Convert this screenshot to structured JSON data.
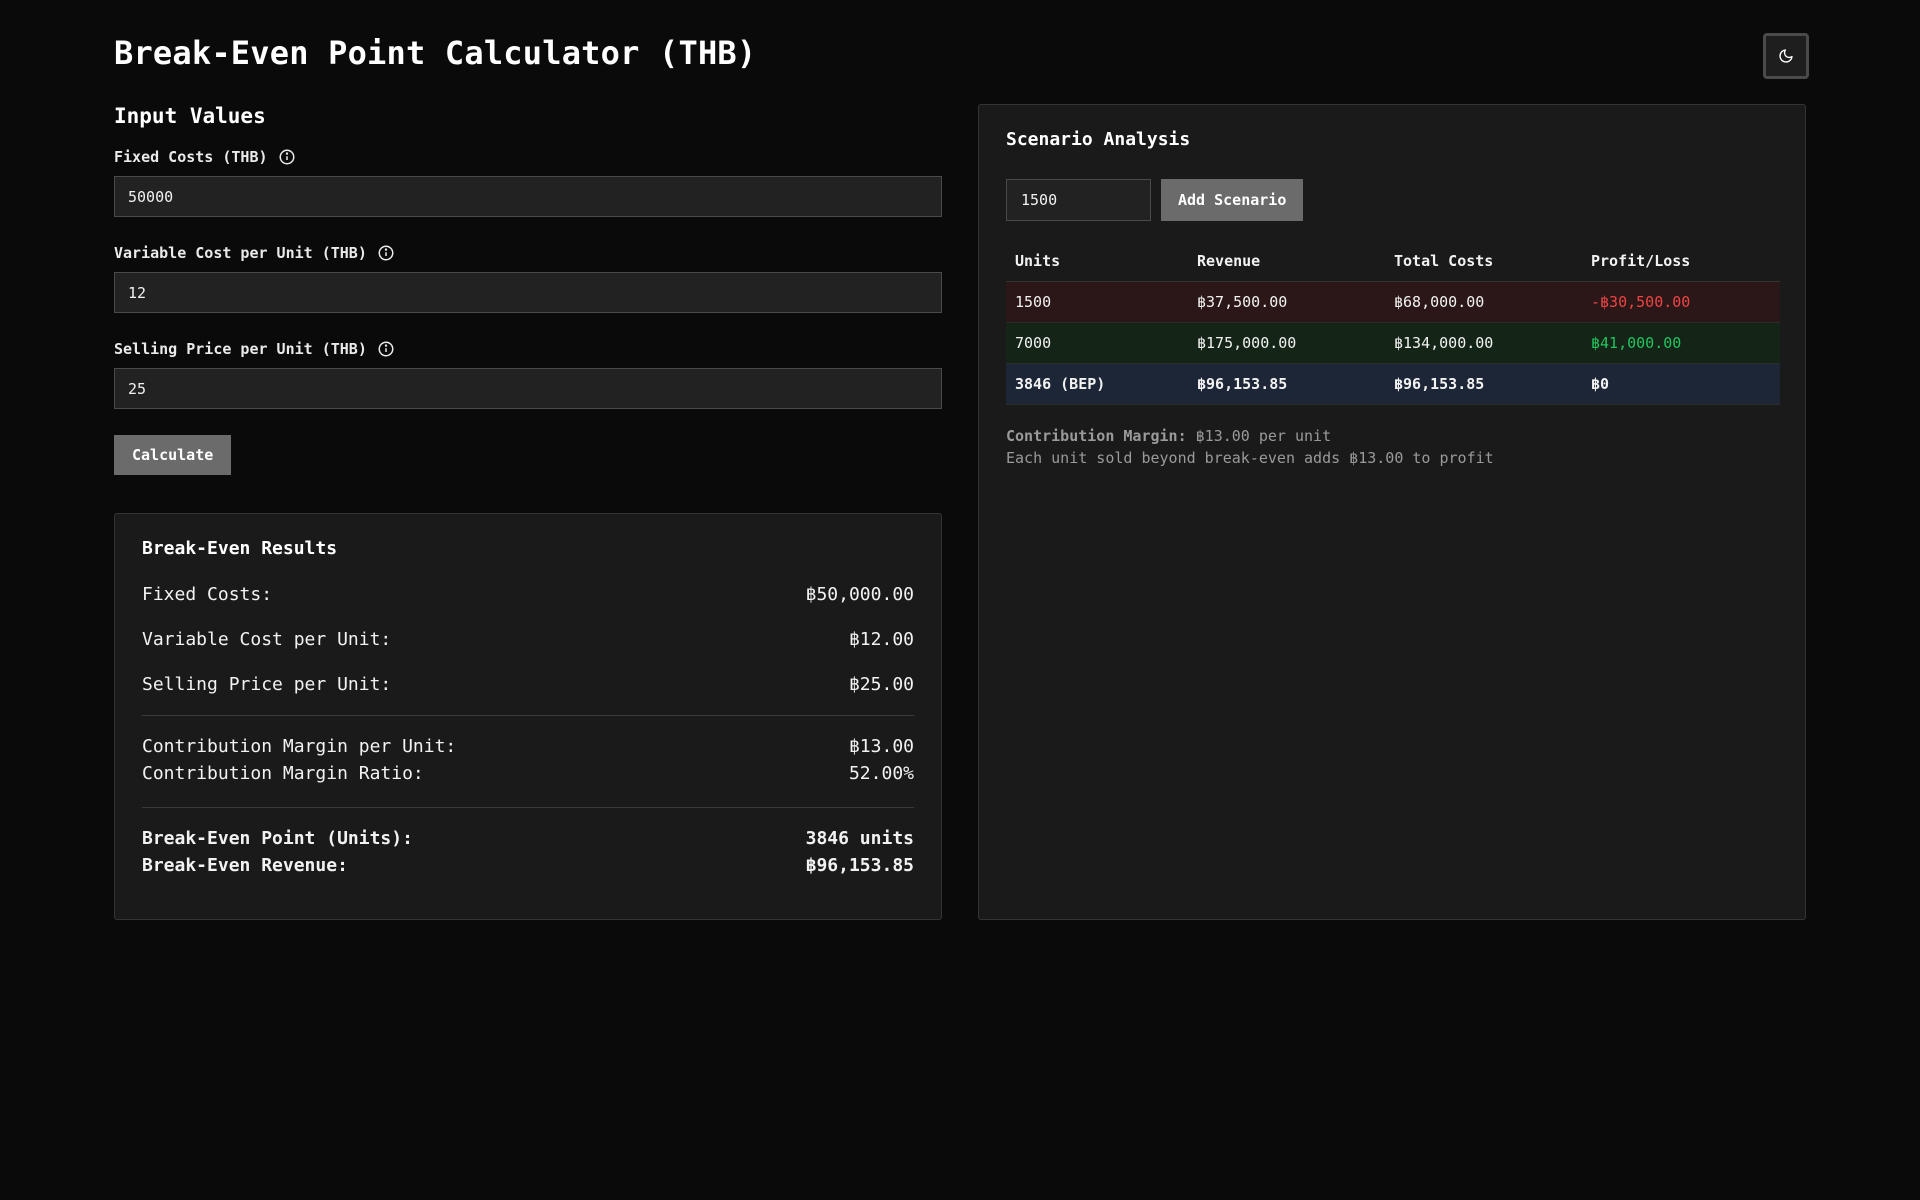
{
  "header": {
    "title": "Break-Even Point Calculator (THB)",
    "theme_toggle_icon": "moon-icon"
  },
  "inputs": {
    "section_title": "Input Values",
    "fixed_costs": {
      "label": "Fixed Costs (THB)",
      "value": "50000"
    },
    "variable_cost": {
      "label": "Variable Cost per Unit (THB)",
      "value": "12"
    },
    "selling_price": {
      "label": "Selling Price per Unit (THB)",
      "value": "25"
    },
    "calculate_label": "Calculate"
  },
  "results": {
    "title": "Break-Even Results",
    "fixed_costs_label": "Fixed Costs:",
    "fixed_costs_value": "฿50,000.00",
    "variable_cost_label": "Variable Cost per Unit:",
    "variable_cost_value": "฿12.00",
    "selling_price_label": "Selling Price per Unit:",
    "selling_price_value": "฿25.00",
    "cm_unit_label": "Contribution Margin per Unit:",
    "cm_unit_value": "฿13.00",
    "cm_ratio_label": "Contribution Margin Ratio:",
    "cm_ratio_value": "52.00%",
    "bep_units_label": "Break-Even Point (Units):",
    "bep_units_value": "3846 units",
    "bep_revenue_label": "Break-Even Revenue:",
    "bep_revenue_value": "฿96,153.85"
  },
  "scenario": {
    "title": "Scenario Analysis",
    "input_value": "1500",
    "add_label": "Add Scenario",
    "columns": [
      "Units",
      "Revenue",
      "Total Costs",
      "Profit/Loss"
    ],
    "rows": [
      {
        "units": "1500",
        "revenue": "฿37,500.00",
        "total_costs": "฿68,000.00",
        "profit": "-฿30,500.00"
      },
      {
        "units": "7000",
        "revenue": "฿175,000.00",
        "total_costs": "฿134,000.00",
        "profit": "฿41,000.00"
      },
      {
        "units": "3846 (BEP)",
        "revenue": "฿96,153.85",
        "total_costs": "฿96,153.85",
        "profit": "฿0"
      }
    ],
    "cm_label": "Contribution Margin:",
    "cm_value": "฿13.00 per unit",
    "cm_note": "Each unit sold beyond break-even adds ฿13.00 to profit"
  },
  "colors": {
    "background": "#0a0a0a",
    "panel": "#1a1a1a",
    "loss_text": "#ef4444",
    "profit_text": "#22c55e",
    "loss_row": "#2b1717",
    "profit_row": "#142417",
    "bep_row": "#1d2636",
    "button": "#6b6b6b"
  }
}
